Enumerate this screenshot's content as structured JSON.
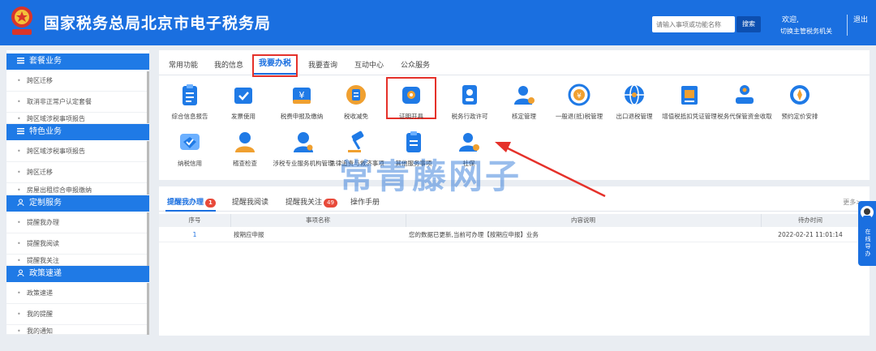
{
  "header": {
    "title": "国家税务总局北京市电子税务局",
    "search_placeholder": "请输入事项或功能名称",
    "search_button": "搜索",
    "welcome": "欢迎,",
    "switch_role": "切换主管税务机关",
    "logout": "退出"
  },
  "sidebar": {
    "sections": [
      {
        "title": "套餐业务",
        "items": [
          "跨区迁移",
          "取消非正常户认定套餐",
          "跨区域涉税事项报告"
        ]
      },
      {
        "title": "特色业务",
        "items": [
          "跨区域涉税事项报告",
          "跨区迁移",
          "房屋出租综合申报缴纳"
        ]
      },
      {
        "title": "定制服务",
        "items": [
          "提醒我办理",
          "提醒我阅读",
          "提醒我关注"
        ]
      },
      {
        "title": "政策速递",
        "items": [
          "政策速递",
          "我的提醒",
          "我的通知"
        ]
      }
    ]
  },
  "main": {
    "tabs": [
      "常用功能",
      "我的信息",
      "我要办税",
      "我要查询",
      "互动中心",
      "公众服务"
    ],
    "active_tab": "我要办税",
    "services_row1": [
      {
        "label": "综合信息报告",
        "icon": "clipboard-icon"
      },
      {
        "label": "发票使用",
        "icon": "invoice-check-icon"
      },
      {
        "label": "税费申报及缴纳",
        "icon": "tax-payment-icon"
      },
      {
        "label": "税收减免",
        "icon": "tax-relief-icon"
      },
      {
        "label": "证明开具",
        "icon": "certificate-icon"
      },
      {
        "label": "税务行政许可",
        "icon": "license-icon"
      },
      {
        "label": "核定管理",
        "icon": "user-settings-icon"
      },
      {
        "label": "一般退(抵)税管理",
        "icon": "refund-icon"
      },
      {
        "label": "出口退税管理",
        "icon": "export-refund-icon"
      },
      {
        "label": "增值税抵扣凭证管理",
        "icon": "voucher-icon"
      },
      {
        "label": "税务代保管资金收取",
        "icon": "deposit-icon"
      },
      {
        "label": "预约定价安排",
        "icon": "pricing-compass-icon"
      }
    ],
    "services_row2": [
      {
        "label": "纳税信用",
        "icon": "credit-icon"
      },
      {
        "label": "稽查检查",
        "icon": "inspection-icon"
      },
      {
        "label": "涉税专业服务机构管理",
        "icon": "agency-icon"
      },
      {
        "label": "法律追责与救济事项",
        "icon": "legal-gavel-icon"
      },
      {
        "label": "其他服务事项",
        "icon": "other-service-icon"
      },
      {
        "label": "社保",
        "icon": "social-security-icon"
      }
    ]
  },
  "panel": {
    "tabs": [
      {
        "label": "提醒我办理",
        "badge": "1"
      },
      {
        "label": "提醒我阅读",
        "badge": ""
      },
      {
        "label": "提醒我关注",
        "badge": "49"
      },
      {
        "label": "操作手册",
        "badge": ""
      }
    ],
    "more": "更多>",
    "columns": [
      "序号",
      "事项名称",
      "内容说明",
      "待办时间"
    ],
    "rows": [
      {
        "no": "1",
        "name": "按期应申报",
        "desc": "您的数据已更新,当前可办理【按期应申报】业务",
        "time": "2022-02-21 11:01:14"
      }
    ]
  },
  "helper": {
    "label": "在线导办"
  },
  "watermark": "常青藤网子",
  "colors": {
    "primary": "#1a6fe0",
    "highlight": "#e5312a",
    "badge": "#e84a3a"
  }
}
